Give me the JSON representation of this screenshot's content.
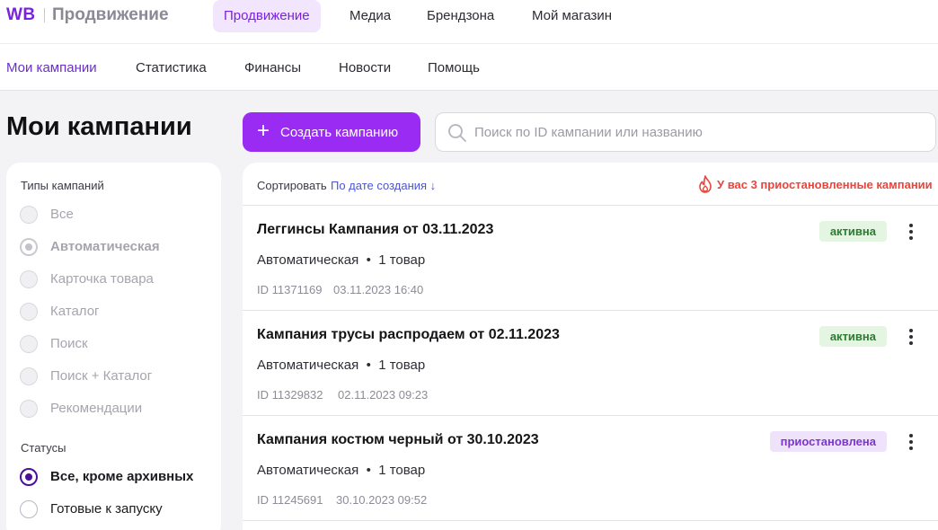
{
  "brand": {
    "logo": "WB",
    "name": "Продвижение"
  },
  "topnav": [
    {
      "label": "Продвижение",
      "active": true
    },
    {
      "label": "Медиа"
    },
    {
      "label": "Брендзона"
    },
    {
      "label": "Мой магазин"
    }
  ],
  "subnav": [
    {
      "label": "Мои кампании",
      "active": true
    },
    {
      "label": "Статистика"
    },
    {
      "label": "Финансы"
    },
    {
      "label": "Новости"
    },
    {
      "label": "Помощь"
    }
  ],
  "page_title": "Мои кампании",
  "create_button": {
    "label": "Создать кампанию",
    "icon": "plus-icon"
  },
  "search": {
    "placeholder": "Поиск по ID кампании или названию",
    "value": ""
  },
  "filters": {
    "types_heading": "Типы кампаний",
    "types": [
      {
        "label": "Все",
        "state": "disabled"
      },
      {
        "label": "Автоматическая",
        "state": "selected-disabled"
      },
      {
        "label": "Карточка товара",
        "state": "disabled"
      },
      {
        "label": "Каталог",
        "state": "disabled"
      },
      {
        "label": "Поиск",
        "state": "disabled"
      },
      {
        "label": "Поиск + Каталог",
        "state": "disabled"
      },
      {
        "label": "Рекомендации",
        "state": "disabled"
      }
    ],
    "statuses_heading": "Статусы",
    "statuses": [
      {
        "label": "Все, кроме архивных",
        "state": "selected"
      },
      {
        "label": "Готовые к запуску",
        "state": "enabled"
      }
    ]
  },
  "list": {
    "sort_label": "Сортировать",
    "sort_value": "По дате создания ↓",
    "warning": "У вас 3 приостановленные кампании",
    "warning_color": "#e8453c",
    "campaigns": [
      {
        "title": "Леггинсы Кампания от 03.11.2023",
        "type": "Автоматическая  •  1 товар",
        "id": "ID 11371169",
        "created": "03.11.2023 16:40",
        "status": "активна",
        "status_kind": "active"
      },
      {
        "title": "Кампания трусы распродаем от 02.11.2023",
        "type": "Автоматическая  •  1 товар",
        "id": "ID 11329832",
        "created": "02.11.2023 09:23",
        "status": "активна",
        "status_kind": "active"
      },
      {
        "title": "Кампания костюм черный от 30.10.2023",
        "type": "Автоматическая  •  1 товар",
        "id": "ID 11245691",
        "created": "30.10.2023 09:52",
        "status": "приостановлена",
        "status_kind": "paused"
      }
    ]
  },
  "colors": {
    "accent": "#9a2bf3",
    "brand": "#7a22e0",
    "active_badge": "#e4f5e2",
    "paused_badge": "#efe3fc"
  }
}
